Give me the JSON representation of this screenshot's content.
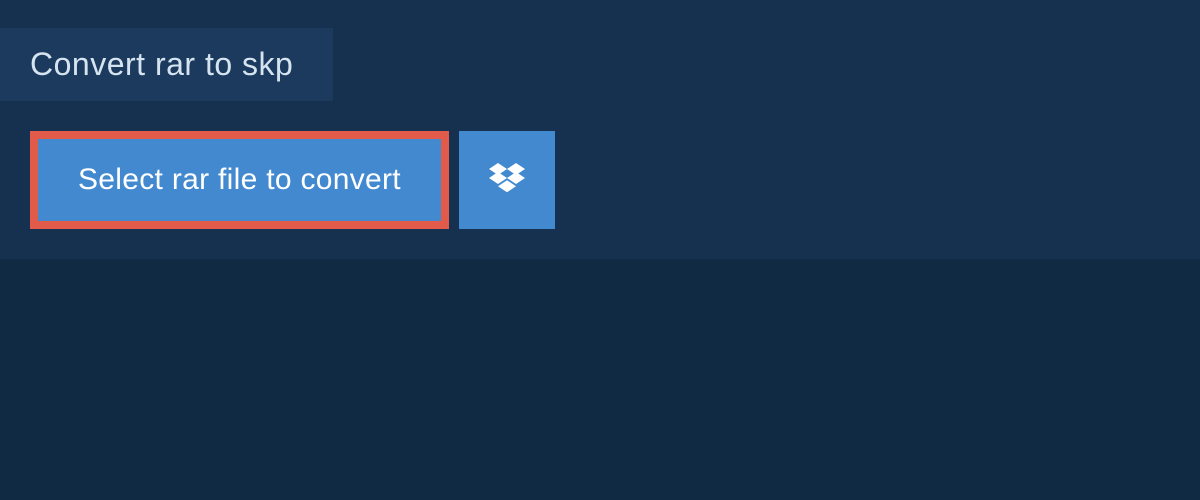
{
  "panel": {
    "tab_title": "Convert rar to skp",
    "select_button_label": "Select rar file to convert"
  }
}
